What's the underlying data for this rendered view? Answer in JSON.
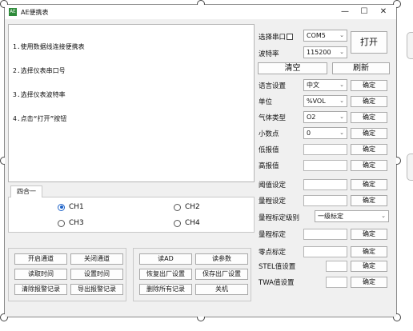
{
  "window": {
    "title": "AE便携表",
    "icon_text": "AE",
    "controls": {
      "minimize": "—",
      "maximize": "☐",
      "close": "✕"
    }
  },
  "log": {
    "lines": [
      "1.使用数据线连接便携表",
      "2.选择仪表串口号",
      "3.选择仪表波特率",
      "4.点击“打开”按钮"
    ]
  },
  "channel_tab": {
    "tab_label": "四合一",
    "channels": [
      "CH1",
      "CH2",
      "CH3",
      "CH4"
    ],
    "selected": "CH1"
  },
  "buttons": {
    "group1": [
      "开启通道",
      "关闭通道",
      "读取时间",
      "设置时间",
      "清除报警记录",
      "导出报警记录"
    ],
    "group2": [
      "读AD",
      "读参数",
      "恢复出厂设置",
      "保存出厂设置",
      "删除所有记录",
      "关机"
    ]
  },
  "serial": {
    "port_label": "选择串口",
    "port_value": "COM5",
    "baud_label": "波特率",
    "baud_value": "115200",
    "open_button": "打开",
    "clear_button": "清空",
    "refresh_button": "刷新"
  },
  "settings": {
    "confirm_label": "确定",
    "rows": [
      {
        "label": "语言设置",
        "value": "中文",
        "type": "select"
      },
      {
        "label": "单位",
        "value": "%VOL",
        "type": "select"
      },
      {
        "label": "气体类型",
        "value": "O2",
        "type": "select"
      },
      {
        "label": "小数点",
        "value": "0",
        "type": "select"
      },
      {
        "label": "低报值",
        "value": "",
        "type": "input"
      },
      {
        "label": "高报值",
        "value": "",
        "type": "input"
      },
      {
        "label": "阈值设定",
        "value": "",
        "type": "input"
      },
      {
        "label": "量程设定",
        "value": "",
        "type": "input"
      }
    ],
    "calib_level_label": "量程标定级别",
    "calib_level_value": "一级标定",
    "calib_rows": [
      {
        "label": "量程标定",
        "value": ""
      },
      {
        "label": "零点标定",
        "value": ""
      },
      {
        "label": "STEL值设置",
        "value": ""
      },
      {
        "label": "TWA值设置",
        "value": ""
      }
    ]
  }
}
